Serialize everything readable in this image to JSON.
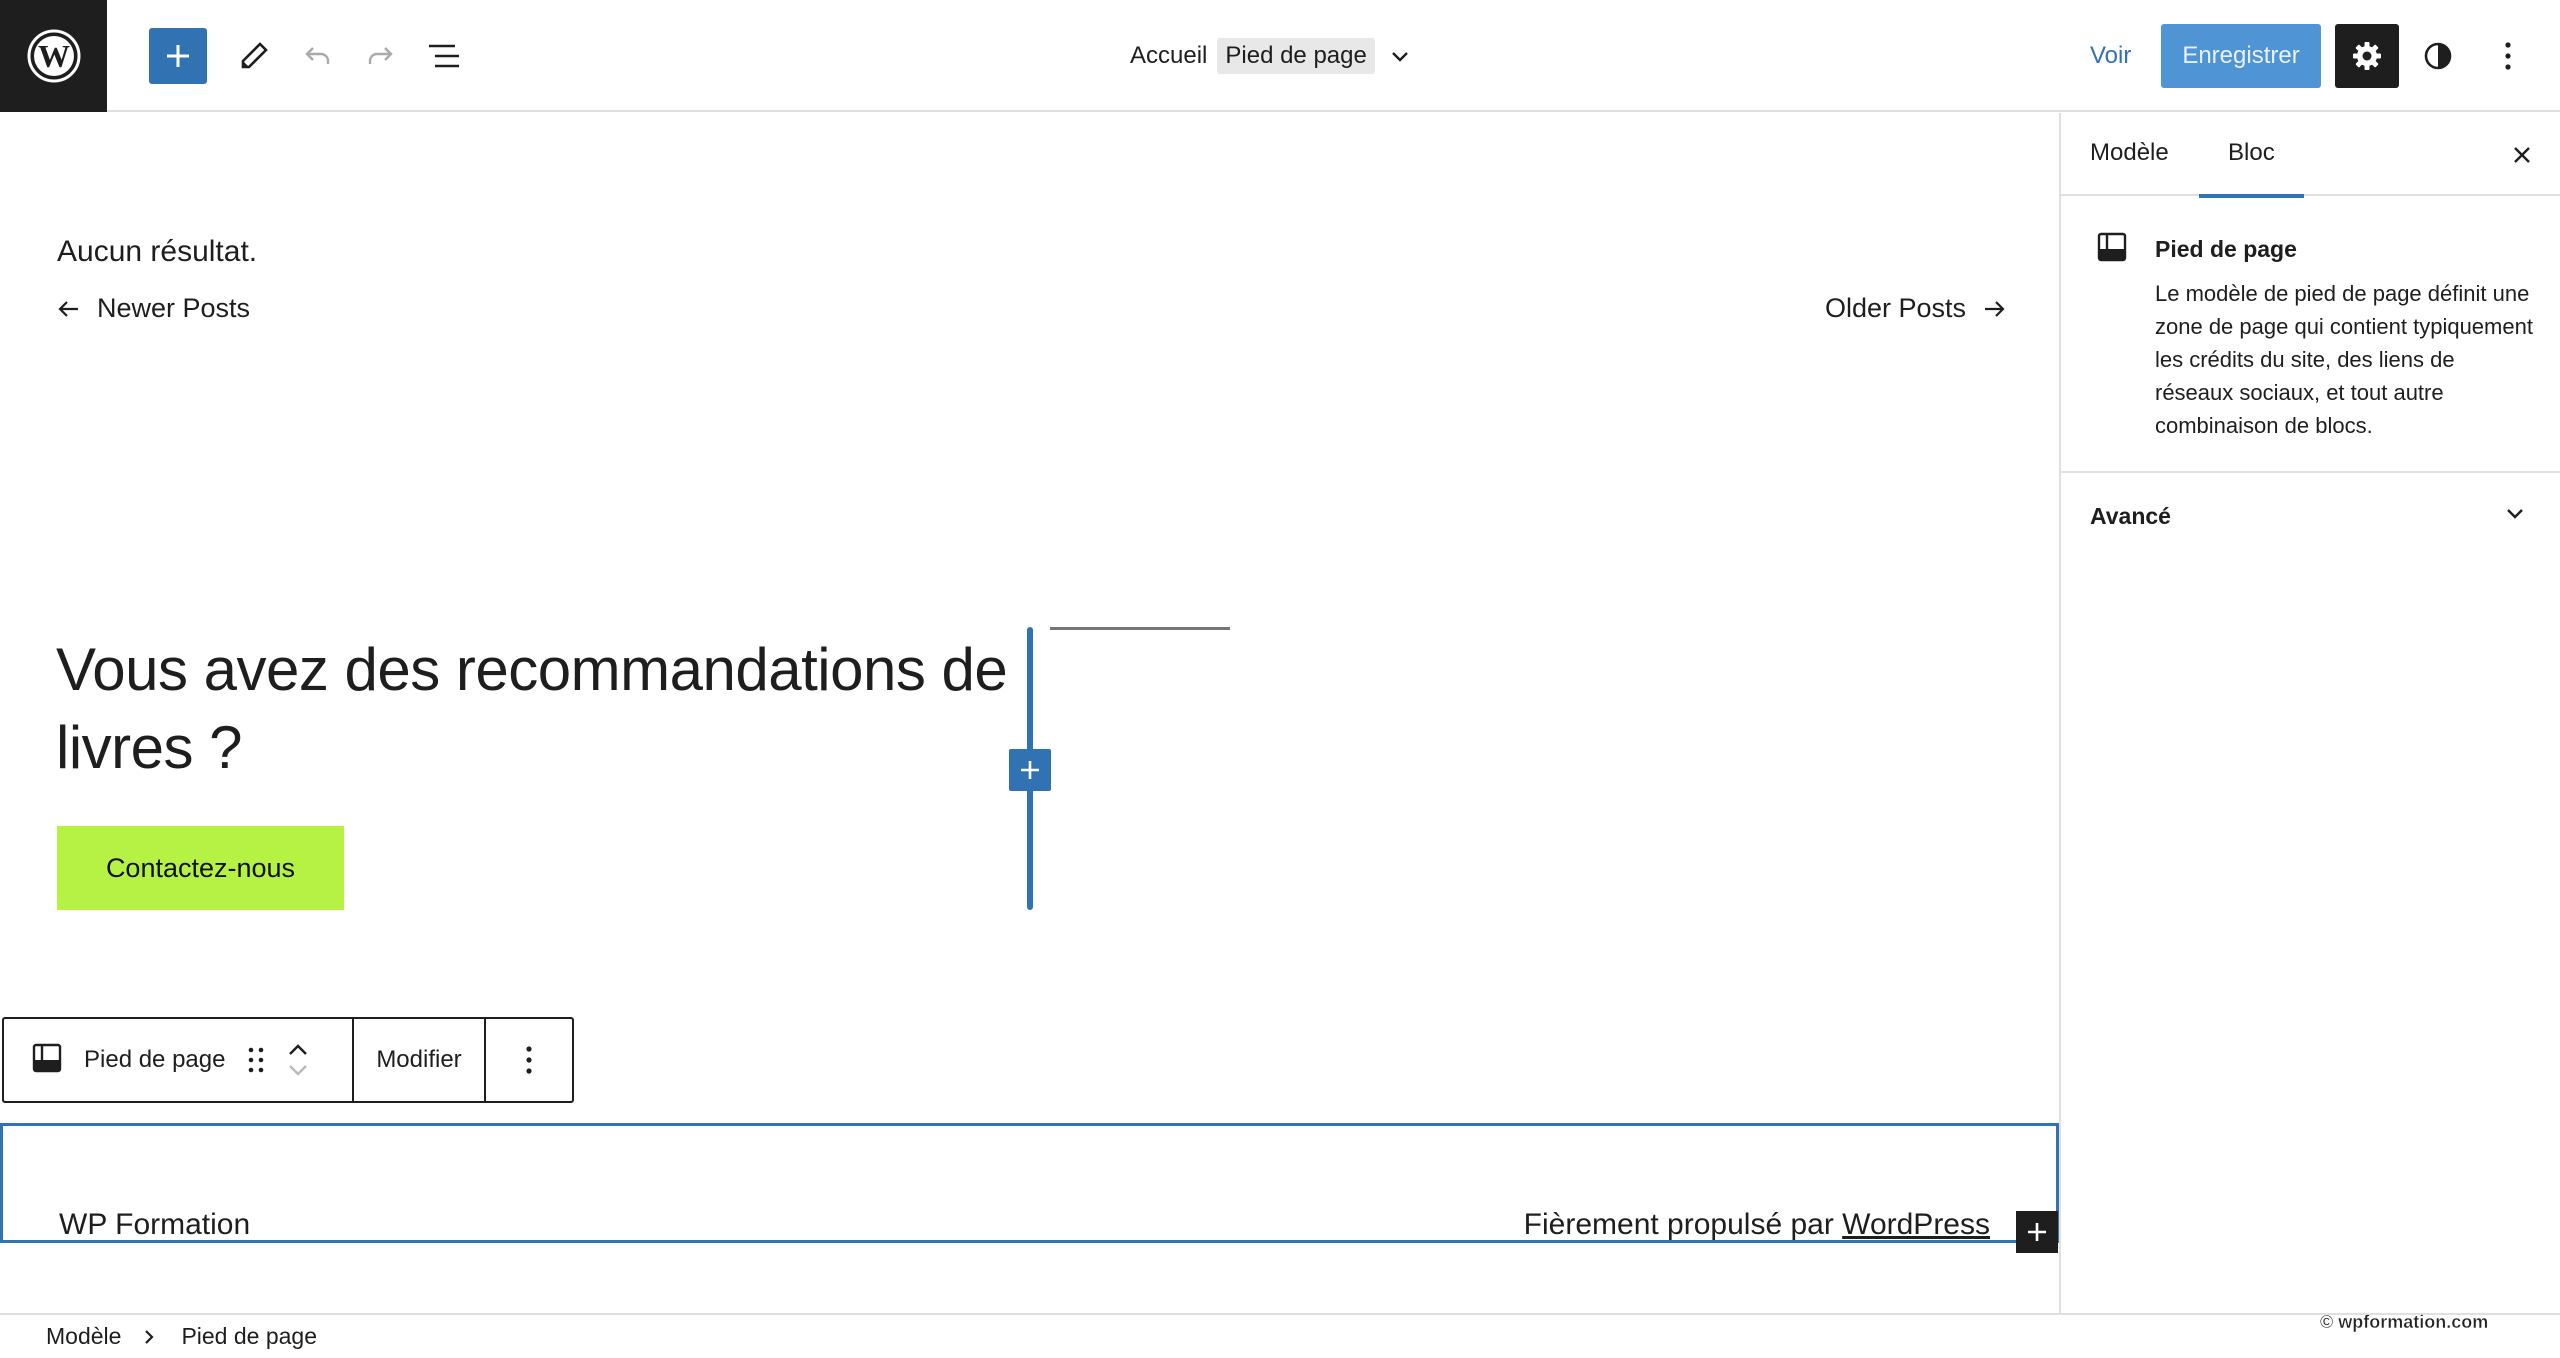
{
  "header": {
    "breadcrumb_home": "Accueil",
    "template_name": "Pied de page",
    "view_label": "Voir",
    "save_label": "Enregistrer"
  },
  "canvas": {
    "no_results": "Aucun résultat.",
    "newer_posts": "Newer Posts",
    "older_posts": "Older Posts",
    "heading": "Vous avez des recommandations de livres ?",
    "contact_button": "Contactez-nous",
    "contact_button_color": "#b6f244"
  },
  "block_toolbar": {
    "block_name": "Pied de page",
    "modify_label": "Modifier"
  },
  "footer": {
    "site_name": "WP Formation",
    "powered_prefix": "Fièrement propulsé par ",
    "powered_link": "WordPress"
  },
  "sidebar": {
    "tabs": [
      {
        "label": "Modèle",
        "active": false
      },
      {
        "label": "Bloc",
        "active": true
      }
    ],
    "block_title": "Pied de page",
    "block_description": "Le modèle de pied de page définit une zone de page qui contient typiquement les crédits du site, des liens de réseaux sociaux, et tout autre combinaison de blocs.",
    "advanced_label": "Avancé"
  },
  "breadcrumb": {
    "items": [
      "Modèle",
      "Pied de page"
    ]
  },
  "watermark": "© wpformation.com",
  "colors": {
    "accent": "#3172b3",
    "save_disabled": "#4f94d4",
    "dark": "#1e1e1e"
  },
  "icons": [
    "wordpress-logo-icon",
    "plus-icon",
    "pencil-icon",
    "undo-icon",
    "redo-icon",
    "list-view-icon",
    "chevron-down-icon",
    "gear-icon",
    "contrast-icon",
    "more-vertical-icon",
    "close-icon",
    "arrow-left-icon",
    "arrow-right-icon",
    "footer-template-icon",
    "drag-handle-icon",
    "chevron-up-icon",
    "chevron-right-icon"
  ]
}
